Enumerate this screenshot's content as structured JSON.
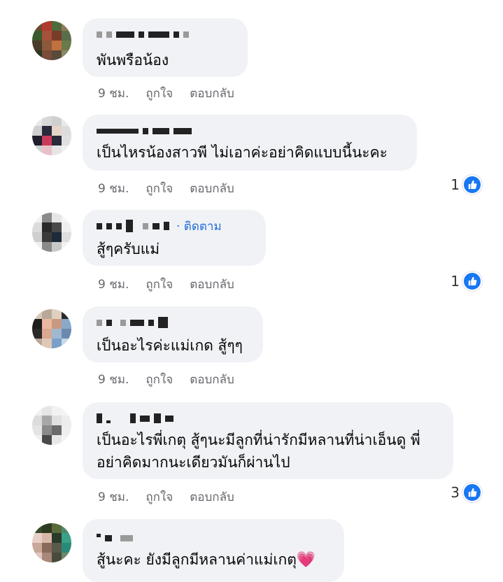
{
  "comments": [
    {
      "text_lines": [
        "พันพรือน้อง"
      ],
      "time": "9 ชม.",
      "like_label": "ถูกใจ",
      "reply_label": "ตอบกลับ",
      "reaction_count": ""
    },
    {
      "text_lines": [
        "เป็นไหรน้องสาวพี ไม่เอาค่ะอย่าคิดแบบนี้นะคะ"
      ],
      "time": "9 ชม.",
      "like_label": "ถูกใจ",
      "reply_label": "ตอบกลับ",
      "reaction_count": "1"
    },
    {
      "follow_label": "· ติดตาม",
      "text_lines": [
        "สู้ๆครับแม่"
      ],
      "time": "9 ชม.",
      "like_label": "ถูกใจ",
      "reply_label": "ตอบกลับ",
      "reaction_count": "1"
    },
    {
      "text_lines": [
        "เป็นอะไรค่ะแม่เกด สู้ๆๆ"
      ],
      "time": "9 ชม.",
      "like_label": "ถูกใจ",
      "reply_label": "ตอบกลับ",
      "reaction_count": ""
    },
    {
      "text_lines": [
        "เป็นอะไรพี่เกตุ สู้ๆนะมีลูกที่น่ารักมีหลานที่น่าเอ็นดู พี่",
        "อย่าคิดมากนะเดียวมันก็ผ่านไป"
      ],
      "time": "9 ชม.",
      "like_label": "ถูกใจ",
      "reply_label": "ตอบกลับ",
      "reaction_count": "3"
    },
    {
      "text_lines": [
        "สู้นะคะ ยังมีลูกมีหลานค่าแม่เกตุ"
      ],
      "emoji": "💗"
    }
  ],
  "colors": {
    "bubble": "#f0f2f5",
    "meta": "#65676b",
    "link": "#216fdb",
    "like": "#1877f2"
  },
  "icons": {
    "reaction": "like-icon",
    "emoji": "heart-icon"
  }
}
